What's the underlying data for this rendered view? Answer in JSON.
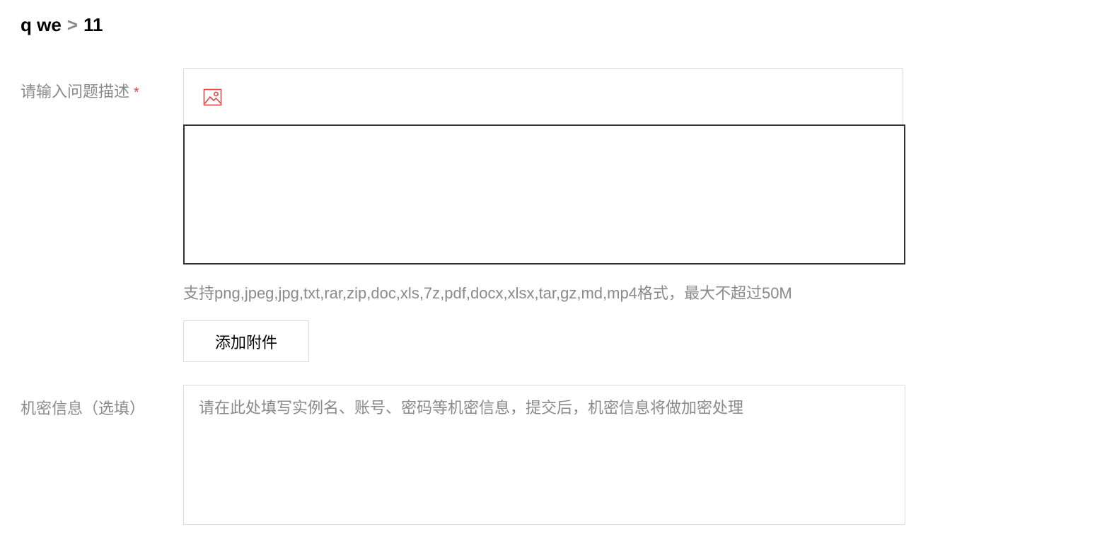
{
  "breadcrumb": {
    "parent": "q we",
    "separator": ">",
    "current": "11"
  },
  "description_field": {
    "label": "请输入问题描述",
    "required_mark": "*",
    "toolbar_icon": "image-icon",
    "accent_color": "#e54545"
  },
  "attachments": {
    "help_text": "支持png,jpeg,jpg,txt,rar,zip,doc,xls,7z,pdf,docx,xlsx,tar,gz,md,mp4格式，最大不超过50M",
    "add_button_label": "添加附件"
  },
  "secret_field": {
    "label": "机密信息（选填）",
    "placeholder": "请在此处填写实例名、账号、密码等机密信息，提交后，机密信息将做加密处理"
  }
}
